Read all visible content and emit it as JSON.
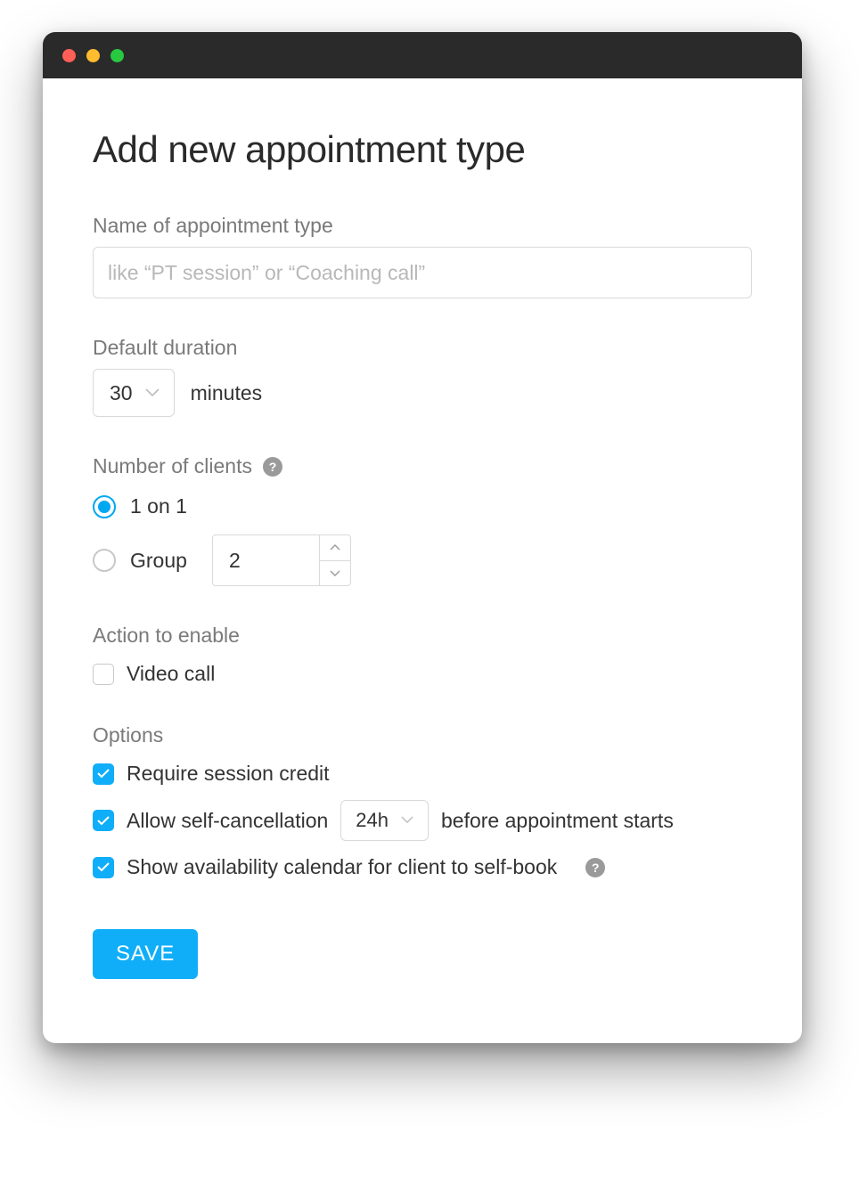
{
  "title": "Add new appointment type",
  "fields": {
    "name": {
      "label": "Name of appointment type",
      "placeholder": "like “PT session” or “Coaching call”",
      "value": ""
    },
    "duration": {
      "label": "Default duration",
      "value": "30",
      "unit": "minutes"
    },
    "clients": {
      "label": "Number of clients",
      "help": "?",
      "options": {
        "one_on_one": {
          "label": "1 on 1",
          "selected": true
        },
        "group": {
          "label": "Group",
          "selected": false,
          "count": "2"
        }
      }
    },
    "action": {
      "label": "Action to enable",
      "video_call": {
        "label": "Video call",
        "checked": false
      }
    },
    "options": {
      "label": "Options",
      "require_credit": {
        "label": "Require session credit",
        "checked": true
      },
      "self_cancel": {
        "label": "Allow self-cancellation",
        "checked": true,
        "window": "24h",
        "suffix": "before appointment starts"
      },
      "show_availability": {
        "label": "Show availability calendar for client to self-book",
        "checked": true,
        "help": "?"
      }
    }
  },
  "save_label": "SAVE"
}
